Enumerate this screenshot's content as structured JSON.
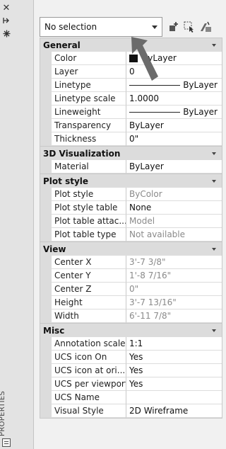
{
  "palette": {
    "title": "PROPERTIES"
  },
  "toolbar": {
    "selection_value": "No selection"
  },
  "icons": {
    "close": "close-icon",
    "autohide": "autohide-icon",
    "settings": "settings-icon",
    "quick_select": "quick-select-icon",
    "select_objects": "select-objects-icon",
    "toggle_pickadd": "toggle-pickadd-icon"
  },
  "categories": [
    {
      "title": "General",
      "rows": [
        {
          "label": "Color",
          "value": "ByLayer",
          "kind": "color",
          "swatch": "#111111"
        },
        {
          "label": "Layer",
          "value": "0"
        },
        {
          "label": "Linetype",
          "value": "ByLayer",
          "kind": "line"
        },
        {
          "label": "Linetype scale",
          "value": "1.0000"
        },
        {
          "label": "Lineweight",
          "value": "ByLayer",
          "kind": "line"
        },
        {
          "label": "Transparency",
          "value": "ByLayer"
        },
        {
          "label": "Thickness",
          "value": "0\""
        }
      ]
    },
    {
      "title": "3D Visualization",
      "rows": [
        {
          "label": "Material",
          "value": "ByLayer"
        }
      ]
    },
    {
      "title": "Plot style",
      "rows": [
        {
          "label": "Plot style",
          "value": "ByColor",
          "readonly": true
        },
        {
          "label": "Plot style table",
          "value": "None"
        },
        {
          "label": "Plot table attac...",
          "value": "Model",
          "readonly": true
        },
        {
          "label": "Plot table type",
          "value": "Not available",
          "readonly": true
        }
      ]
    },
    {
      "title": "View",
      "rows": [
        {
          "label": "Center X",
          "value": "3'-7 3/8\"",
          "readonly": true
        },
        {
          "label": "Center Y",
          "value": "1'-8 7/16\"",
          "readonly": true
        },
        {
          "label": "Center Z",
          "value": "0\"",
          "readonly": true
        },
        {
          "label": "Height",
          "value": "3'-7 13/16\"",
          "readonly": true
        },
        {
          "label": "Width",
          "value": "6'-11 7/8\"",
          "readonly": true
        }
      ]
    },
    {
      "title": "Misc",
      "rows": [
        {
          "label": "Annotation scale",
          "value": "1:1"
        },
        {
          "label": "UCS icon On",
          "value": "Yes"
        },
        {
          "label": "UCS icon at ori...",
          "value": "Yes"
        },
        {
          "label": "UCS per viewport",
          "value": "Yes"
        },
        {
          "label": "UCS Name",
          "value": ""
        },
        {
          "label": "Visual Style",
          "value": "2D Wireframe"
        }
      ]
    }
  ]
}
